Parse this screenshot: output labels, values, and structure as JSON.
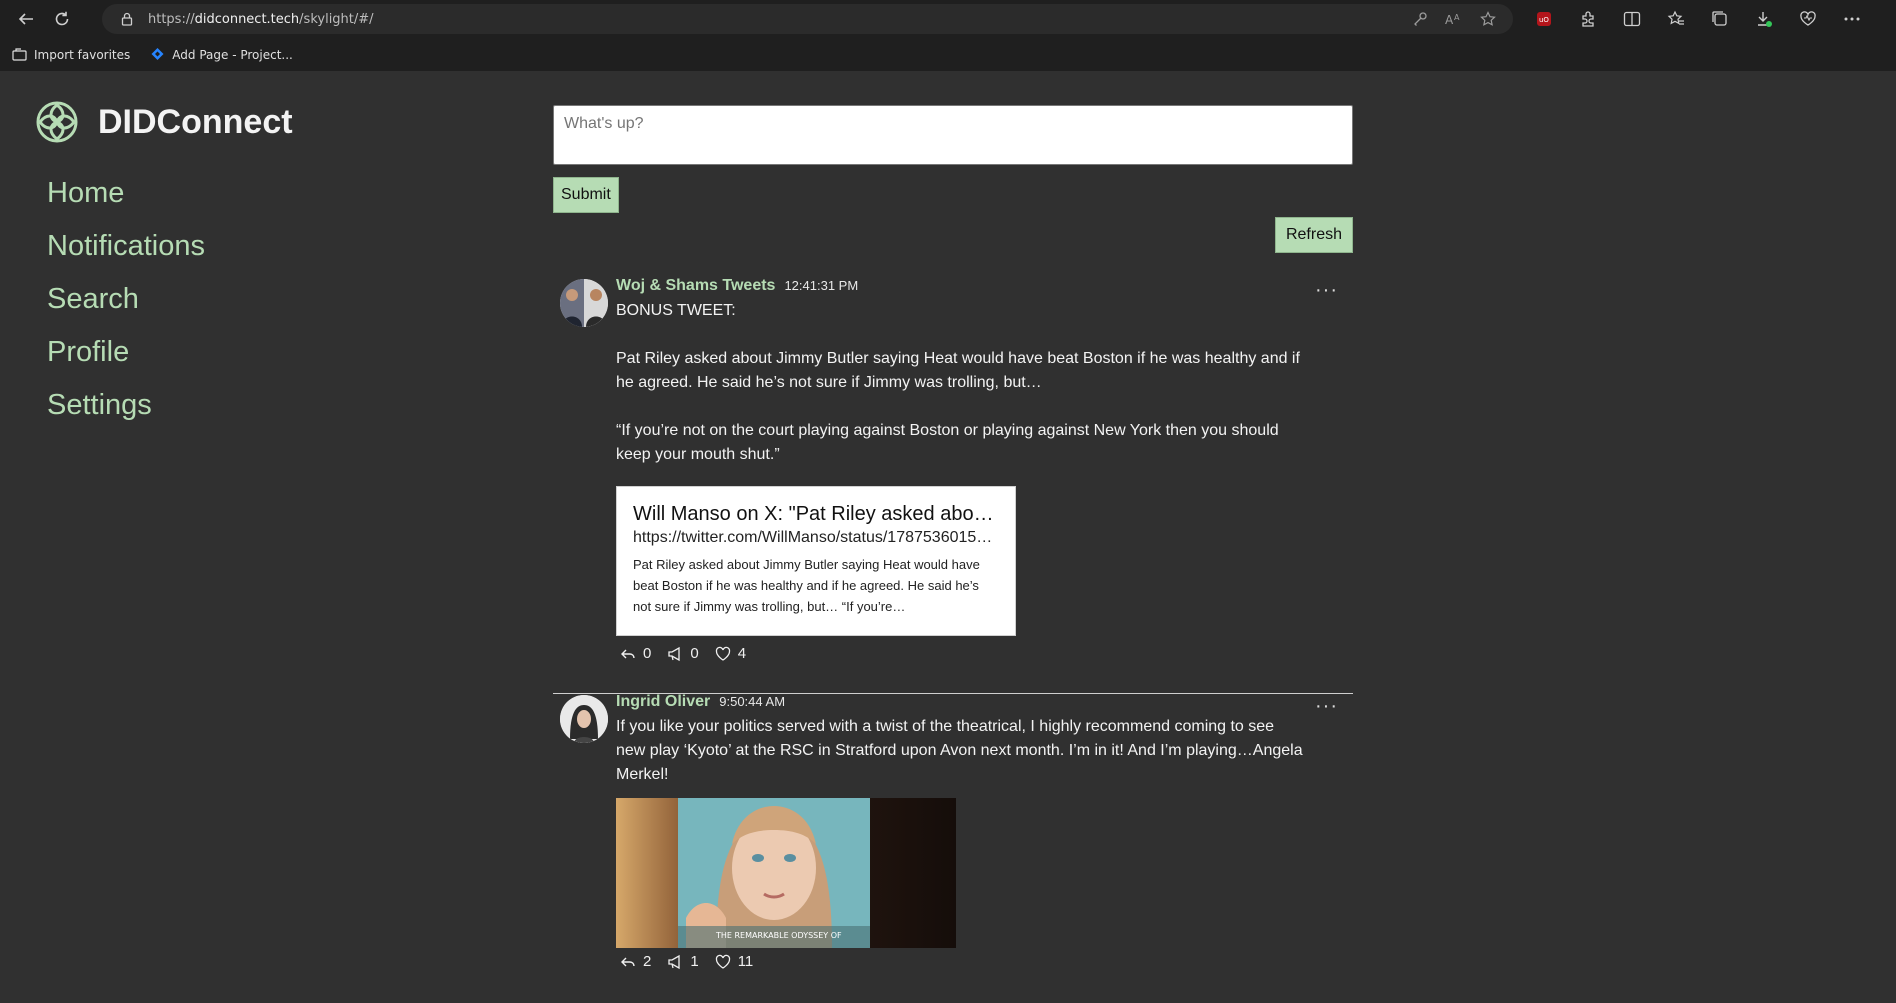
{
  "browser": {
    "url_scheme": "https://",
    "url_host": "didconnect.tech",
    "url_path": "/skylight/#/",
    "favorites": [
      {
        "label": "Import favorites"
      },
      {
        "label": "Add Page - Project..."
      }
    ]
  },
  "app": {
    "name": "DIDConnect",
    "nav": [
      "Home",
      "Notifications",
      "Search",
      "Profile",
      "Settings"
    ],
    "compose_placeholder": "What's up?",
    "submit_label": "Submit",
    "refresh_label": "Refresh"
  },
  "posts": [
    {
      "author": "Woj & Shams Tweets",
      "time": "12:41:31 PM",
      "text": "BONUS TWEET:\n\nPat Riley asked about Jimmy Butler saying Heat would have beat Boston if he was healthy and if he agreed. He said he’s not sure if Jimmy was trolling, but…\n\n“If you’re not on the court playing against Boston or playing against New York then you should keep your mouth shut.”",
      "card": {
        "title": "Will Manso on X: \"Pat Riley asked abo…",
        "url": "https://twitter.com/WillManso/status/1787536015…",
        "description": "Pat Riley asked about Jimmy Butler saying Heat would have beat Boston if he was healthy and if he agreed. He said he’s not sure if Jimmy was trolling, but… “If you’re…"
      },
      "replies": "0",
      "reposts": "0",
      "likes": "4"
    },
    {
      "author": "Ingrid Oliver",
      "time": "9:50:44 AM",
      "text": "If you like your politics served with a twist of the theatrical, I highly recommend coming to see new play ‘Kyoto’ at the RSC in Stratford upon Avon next month. I’m in it! And I’m playing…Angela Merkel!",
      "image_caption": "THE REMARKABLE ODYSSEY OF",
      "replies": "2",
      "reposts": "1",
      "likes": "11"
    }
  ],
  "colors": {
    "accent": "#b6dcb4",
    "background": "#303030",
    "chrome": "#1f1f1f"
  }
}
